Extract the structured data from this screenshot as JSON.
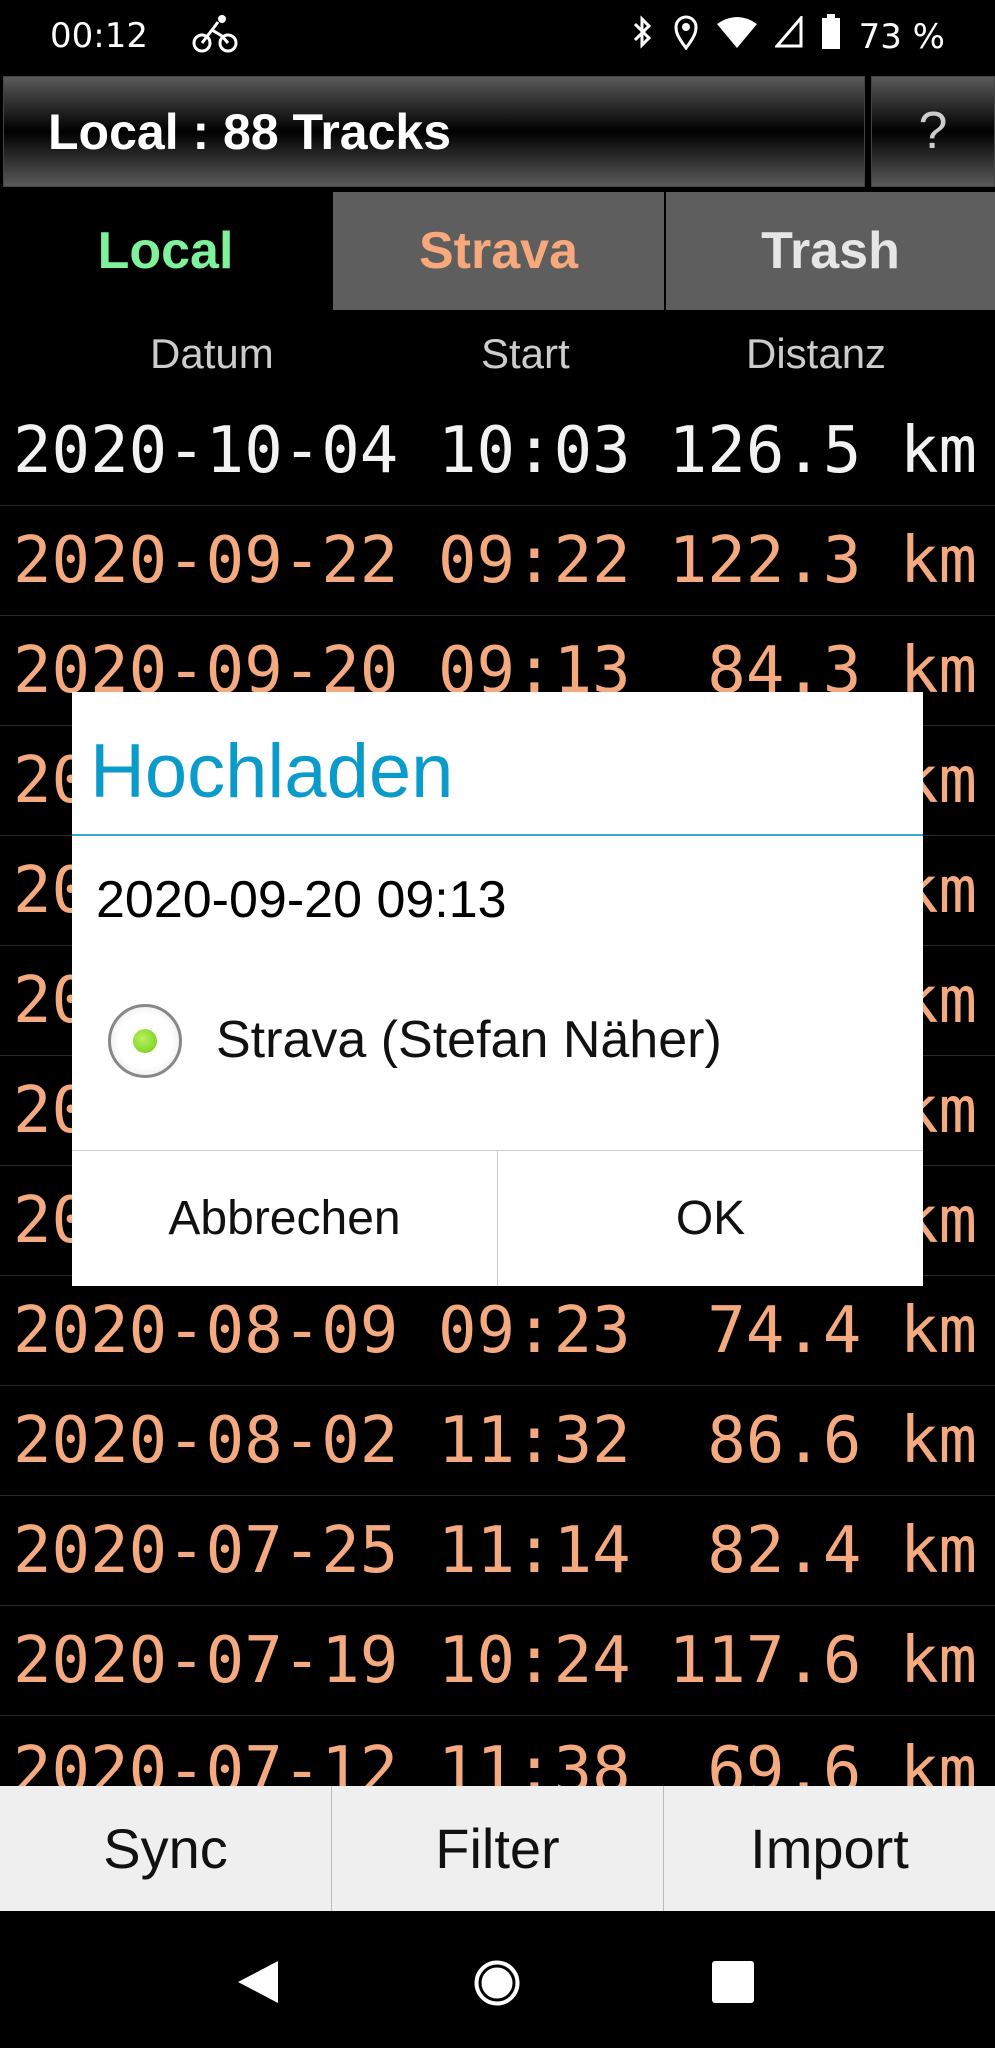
{
  "status_bar": {
    "time": "00:12",
    "notification_icon": "bicycle-icon",
    "battery": "73 %",
    "icons": [
      "bluetooth-icon",
      "location-icon",
      "wifi-icon",
      "signal-icon",
      "battery-icon"
    ]
  },
  "header": {
    "title": "Local :  88 Tracks",
    "help_label": "?"
  },
  "tabs": [
    {
      "label": "Local",
      "color": "#7df29a",
      "active": true
    },
    {
      "label": "Strava",
      "color": "#f7a97c"
    },
    {
      "label": "Trash",
      "color": "#e6e6e6"
    }
  ],
  "columns": {
    "date": "Datum",
    "start": "Start",
    "distance": "Distanz"
  },
  "rows": [
    {
      "date": "2020-10-04",
      "start": "10:03",
      "distance": "126.5 km"
    },
    {
      "date": "2020-09-22",
      "start": "09:22",
      "distance": "122.3 km"
    },
    {
      "date": "2020-09-20",
      "start": "09:13",
      "distance": "84.3 km"
    },
    {
      "date": "20",
      "start": "",
      "distance": "km"
    },
    {
      "date": "20",
      "start": "",
      "distance": "km"
    },
    {
      "date": "20",
      "start": "",
      "distance": "km"
    },
    {
      "date": "20",
      "start": "",
      "distance": "km"
    },
    {
      "date": "20",
      "start": "",
      "distance": "km"
    },
    {
      "date": "2020-08-09",
      "start": "09:23",
      "distance": "74.4 km"
    },
    {
      "date": "2020-08-02",
      "start": "11:32",
      "distance": "86.6 km"
    },
    {
      "date": "2020-07-25",
      "start": "11:14",
      "distance": "82.4 km"
    },
    {
      "date": "2020-07-19",
      "start": "10:24",
      "distance": "117.6 km"
    },
    {
      "date": "2020-07-12",
      "start": "11:38",
      "distance": "69.6 km"
    }
  ],
  "dialog": {
    "title": "Hochladen",
    "subtitle": "2020-09-20 09:13",
    "option_label": "Strava (Stefan Näher)",
    "option_selected": true,
    "cancel_label": "Abbrechen",
    "ok_label": "OK",
    "title_color": "#0a9bcb"
  },
  "bottom_buttons": [
    "Sync",
    "Filter",
    "Import"
  ],
  "colors": {
    "row_text": "#f5a97f",
    "first_row_text": "#f2f2f2"
  }
}
